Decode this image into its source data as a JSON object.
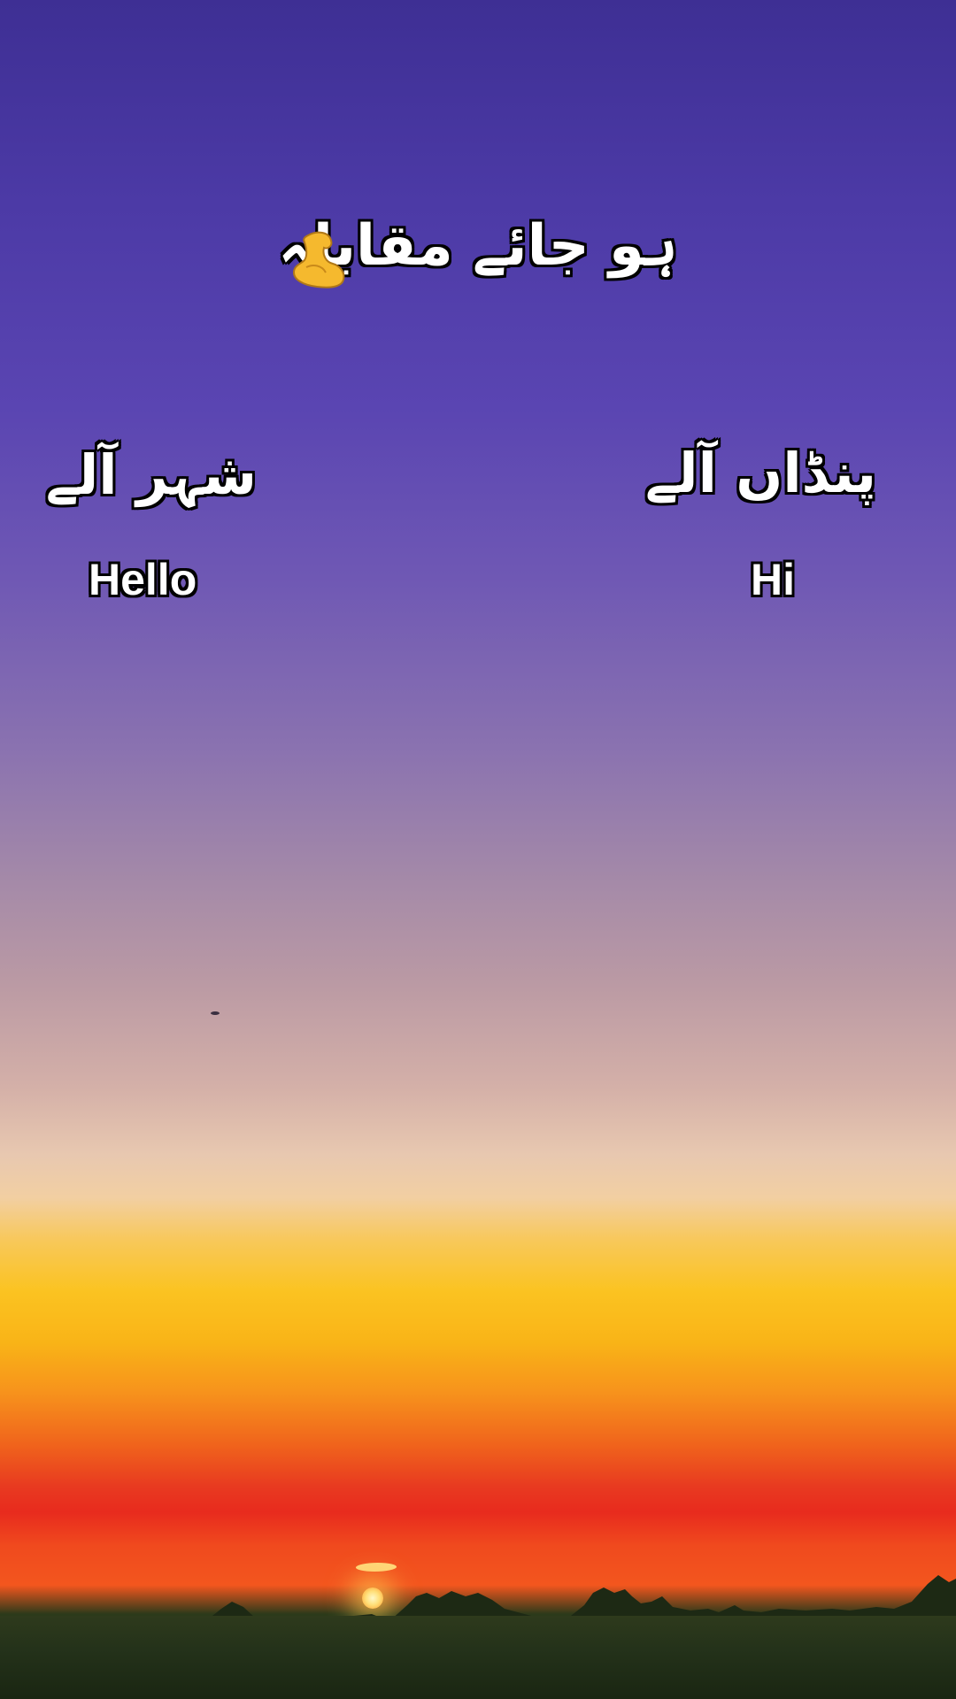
{
  "headline": "ہو جائے مقابلہ",
  "headline_icon": "flexed-biceps-icon",
  "left_label": "شہر آلے",
  "right_label": "پنڈاں آلے",
  "left_greeting": "Hello",
  "right_greeting": "Hi",
  "colors": {
    "sky_top": "#3e2f94",
    "sky_mid": "#a58aa8",
    "sky_glow_yellow": "#fbc321",
    "sky_glow_red": "#e82b1e",
    "ground": "#24321a",
    "text_fill": "#ffffff",
    "text_outline": "#000000"
  }
}
